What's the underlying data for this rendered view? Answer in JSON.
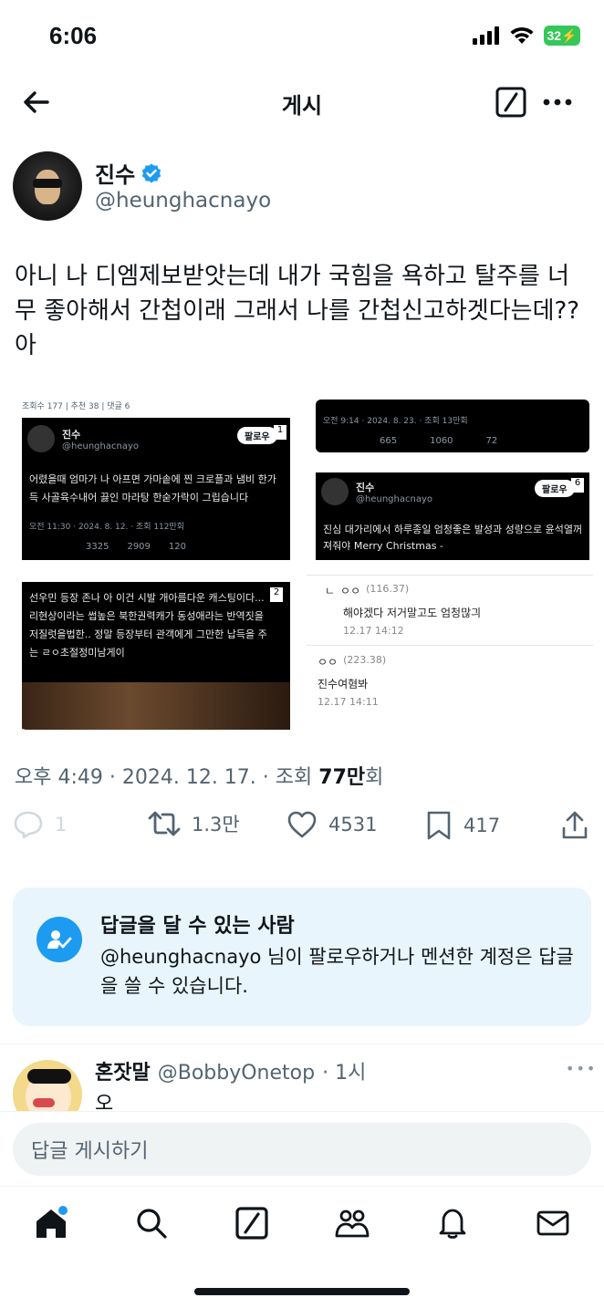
{
  "status_bar": {
    "time": "6:06",
    "battery": "32"
  },
  "header": {
    "title": "게시"
  },
  "author": {
    "name": "진수",
    "handle": "@heunghacnayo"
  },
  "tweet": {
    "text": "아니 나 디엠제보받앗는데 내가 국힘을 욕하고 탈주를 너무 좋아해서 간첩이래 그래서 나를 간첩신고하겟다는데?? 아",
    "meta_prefix": "오후 4:49 · 2024. 12. 17. · 조회 ",
    "views": "77만",
    "views_suffix": "회"
  },
  "images": {
    "img1": {
      "board_meta": "조회수 177 | 추천 38 | 댓글 6",
      "name": "진수",
      "handle": "@heunghacnayo",
      "follow": "팔로우",
      "badge": "1",
      "text": "어렸을때 엄마가 나 아프면 가마솥에 찐 크로플과 냄비 한가득 사골육수내어 끓인 마라탕 한숟가락이 그립습니다",
      "meta": "오전 11:30 · 2024. 8. 12. · 조회 112만회",
      "stats": [
        "3325",
        "2909",
        "120"
      ]
    },
    "img2": {
      "meta": "오전 9:14 · 2024. 8. 23. · 조회 13만회",
      "stats": [
        "665",
        "1060",
        "72"
      ]
    },
    "img3": {
      "name": "진수",
      "handle": "@heunghacnayo",
      "follow": "팔로우",
      "badge": "6",
      "text": "진심 대가리에서 하루종일 엄청좋은 발성과 성량으로 윤석열꺼져줘야 Merry Christmas -"
    },
    "img4": {
      "badge": "2",
      "text": "선우민 등장 존나 아 이건 시발 개아름다운 캐스팅이다... 리현상이라는 썹높은 북한권력캐가 동성애라는 반역짓을 저질럿을법한.. 정말 등장부터 관객에게 그만한 납득을 주는 ㄹㅇ초절정미남게이"
    },
    "img5": {
      "c1_user": "ㅇㅇ",
      "c1_ip": "(116.37)",
      "c1_text": "해야겠다 저거말고도 엄청많긔",
      "c1_time": "12.17 14:12",
      "c2_user": "ㅇㅇ",
      "c2_ip": "(223.38)",
      "c2_text": "진수여혐봐",
      "c2_time": "12.17 14:11"
    }
  },
  "actions": {
    "reply": "1",
    "retweet": "1.3만",
    "like": "4531",
    "bookmark": "417"
  },
  "notice": {
    "title": "답글을 달 수 있는 사람",
    "body": "@heunghacnayo 님이 팔로우하거나 멘션한 계정은 답글을 쓸 수 있습니다."
  },
  "reply": {
    "name": "혼잣말",
    "handle": "@BobbyOnetop",
    "time": "· 1시",
    "text": "오"
  },
  "reply_input": {
    "placeholder": "답글 게시하기"
  },
  "colors": {
    "accent": "#1d9bf0",
    "text": "#0f1419",
    "muted": "#536471",
    "notice_bg": "#e8f5fd"
  }
}
